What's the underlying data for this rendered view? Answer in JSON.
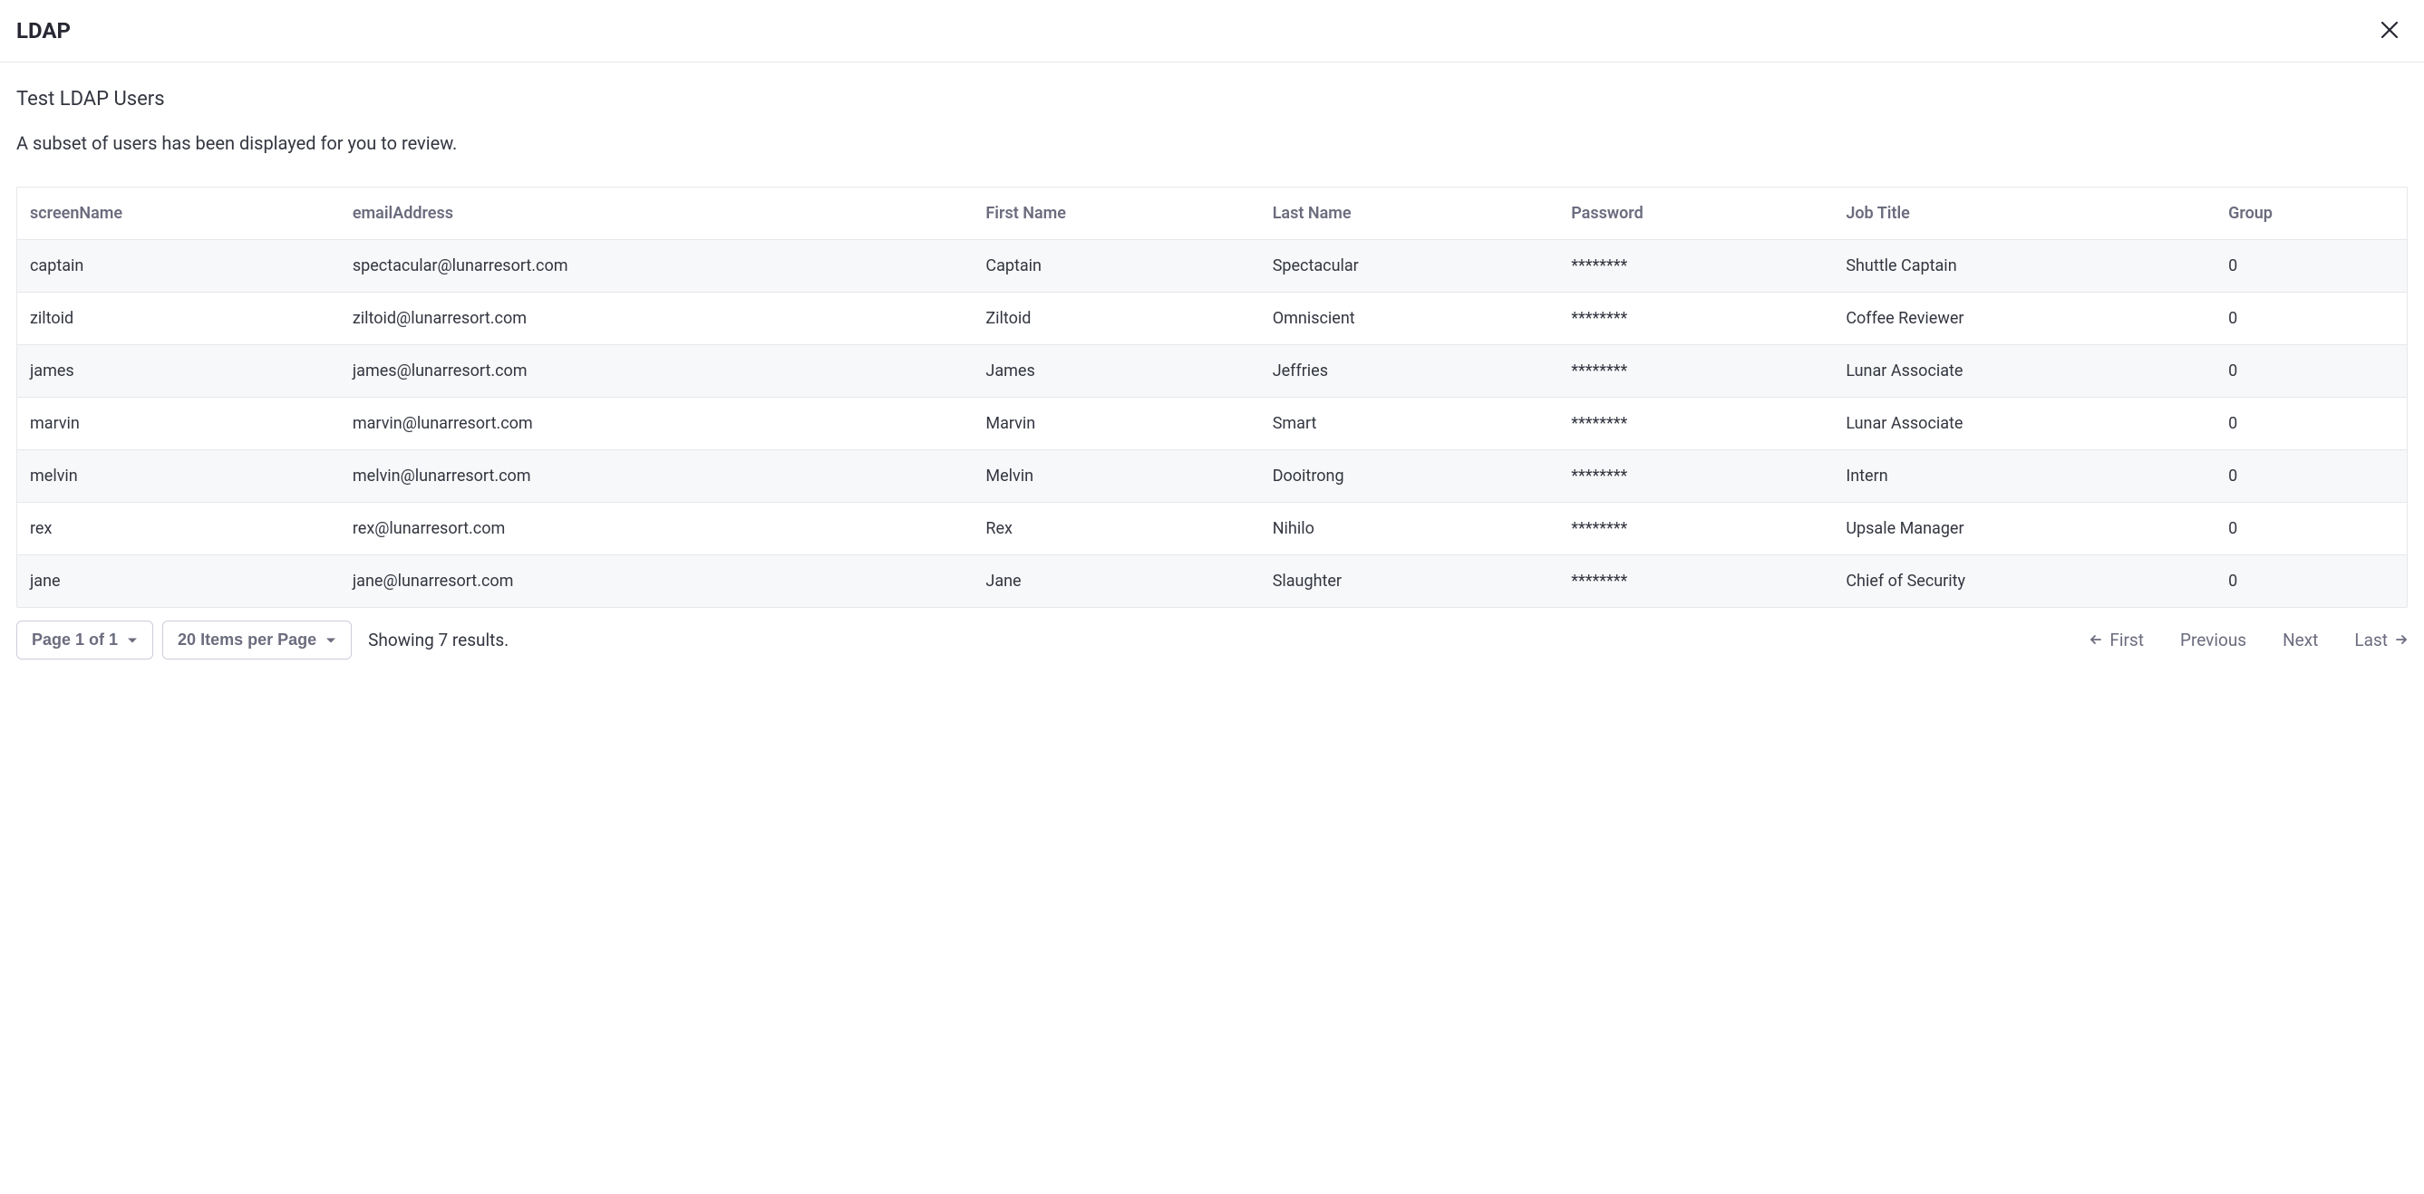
{
  "header": {
    "title": "LDAP"
  },
  "main": {
    "subtitle": "Test LDAP Users",
    "description": "A subset of users has been displayed for you to review."
  },
  "table": {
    "columns": {
      "screenName": "screenName",
      "emailAddress": "emailAddress",
      "firstName": "First Name",
      "lastName": "Last Name",
      "password": "Password",
      "jobTitle": "Job Title",
      "group": "Group"
    },
    "rows": [
      {
        "screenName": "captain",
        "emailAddress": "spectacular@lunarresort.com",
        "firstName": "Captain",
        "lastName": "Spectacular",
        "password": "********",
        "jobTitle": "Shuttle Captain",
        "group": "0"
      },
      {
        "screenName": "ziltoid",
        "emailAddress": "ziltoid@lunarresort.com",
        "firstName": "Ziltoid",
        "lastName": "Omniscient",
        "password": "********",
        "jobTitle": "Coffee Reviewer",
        "group": "0"
      },
      {
        "screenName": "james",
        "emailAddress": "james@lunarresort.com",
        "firstName": "James",
        "lastName": "Jeffries",
        "password": "********",
        "jobTitle": "Lunar Associate",
        "group": "0"
      },
      {
        "screenName": "marvin",
        "emailAddress": "marvin@lunarresort.com",
        "firstName": "Marvin",
        "lastName": "Smart",
        "password": "********",
        "jobTitle": "Lunar Associate",
        "group": "0"
      },
      {
        "screenName": "melvin",
        "emailAddress": "melvin@lunarresort.com",
        "firstName": "Melvin",
        "lastName": "Dooitrong",
        "password": "********",
        "jobTitle": "Intern",
        "group": "0"
      },
      {
        "screenName": "rex",
        "emailAddress": "rex@lunarresort.com",
        "firstName": "Rex",
        "lastName": "Nihilo",
        "password": "********",
        "jobTitle": "Upsale Manager",
        "group": "0"
      },
      {
        "screenName": "jane",
        "emailAddress": "jane@lunarresort.com",
        "firstName": "Jane",
        "lastName": "Slaughter",
        "password": "********",
        "jobTitle": "Chief of Security",
        "group": "0"
      }
    ]
  },
  "pagination": {
    "pageDropdown": "Page 1 of 1",
    "itemsDropdown": "20 Items per Page",
    "resultsText": "Showing 7 results.",
    "first": "First",
    "previous": "Previous",
    "next": "Next",
    "last": "Last"
  }
}
